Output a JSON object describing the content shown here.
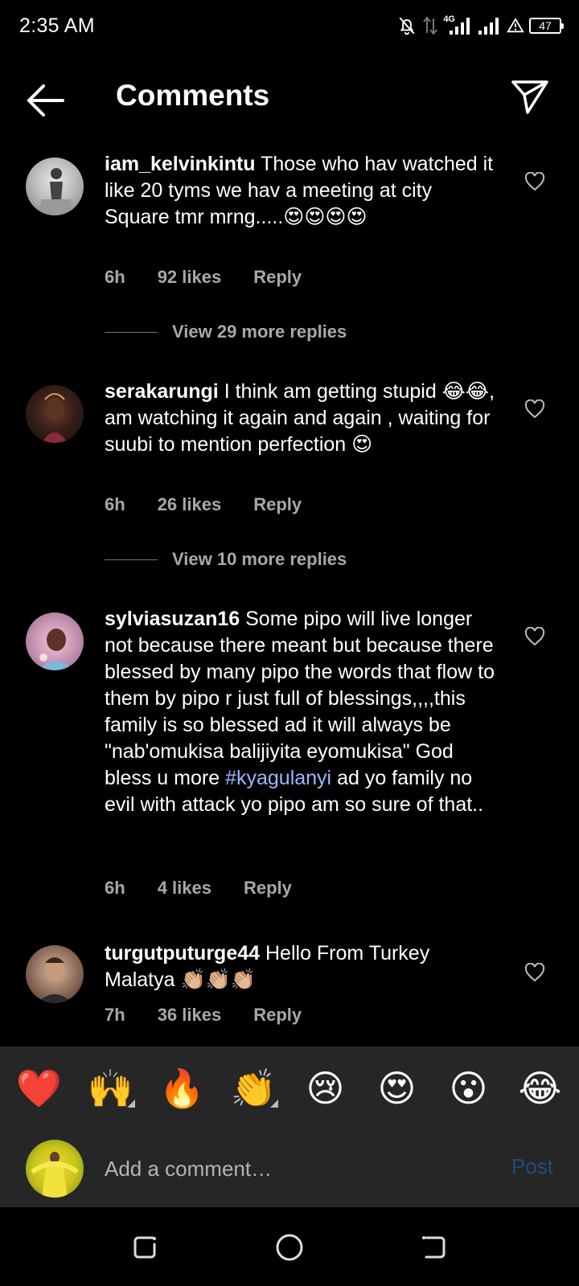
{
  "status_bar": {
    "time": "2:35 AM",
    "network": "4G",
    "battery": "47"
  },
  "header": {
    "title": "Comments"
  },
  "comments": [
    {
      "username": "iam_kelvinkintu",
      "text": "Those who hav watched it like 20 tyms we hav a meeting at city Square tmr mrng.....😍😍😍😍",
      "time": "6h",
      "likes": "92 likes",
      "reply": "Reply",
      "view_replies": "View 29 more replies"
    },
    {
      "username": "serakarungi",
      "text": "I think am getting stupid 😂😂, am watching it again and again , waiting for suubi to mention perfection 😍",
      "time": "6h",
      "likes": "26 likes",
      "reply": "Reply",
      "view_replies": "View 10 more replies"
    },
    {
      "username": "sylviasuzan16",
      "text_before_tag": "Some pipo will live longer not because there meant but because there blessed by many pipo the words that flow to them by pipo r just full of blessings,,,,this family is so blessed ad it will always be \"nab'omukisa balijiyita eyomukisa\" God bless u more",
      "hashtag": "#kyagulanyi",
      "text_after_tag": "ad yo family no evil with attack yo pipo am so sure of that..",
      "time": "6h",
      "likes": "4 likes",
      "reply": "Reply"
    },
    {
      "username": "turgutputurge44",
      "text": "Hello From Turkey Malatya 👏🏼👏🏼👏🏼",
      "time": "7h",
      "likes": "36 likes",
      "reply": "Reply"
    }
  ],
  "emoji_bar": [
    "❤️",
    "🙌",
    "🔥",
    "👏",
    "😢",
    "😍",
    "😮",
    "😂"
  ],
  "composer": {
    "placeholder": "Add a comment…",
    "post_label": "Post"
  }
}
